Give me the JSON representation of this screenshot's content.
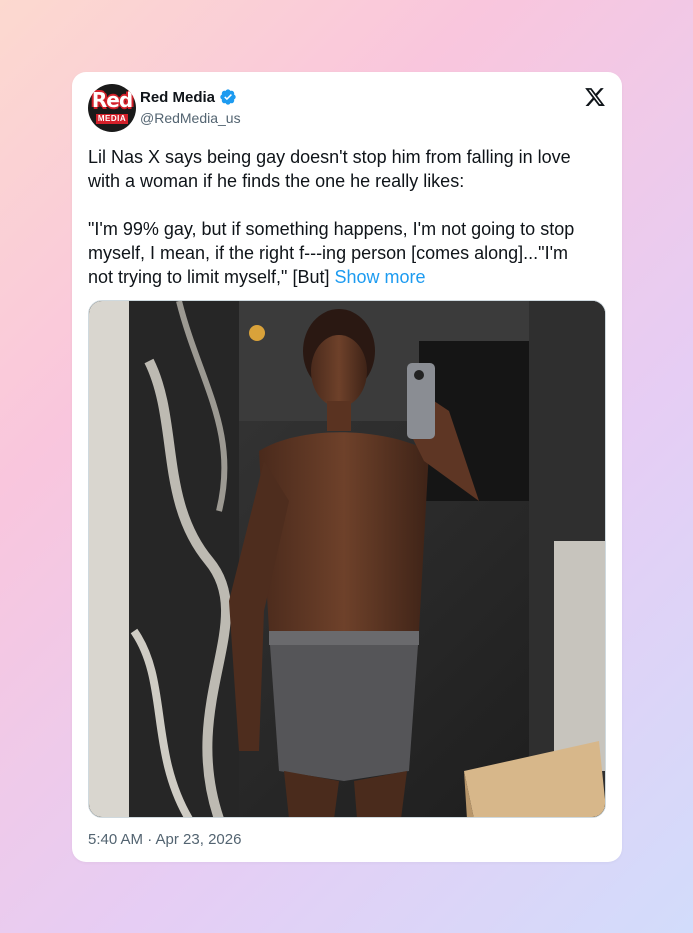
{
  "tweet": {
    "author": {
      "name": "Red Media",
      "handle": "@RedMedia_us",
      "verified": true,
      "avatar_text_top": "Red",
      "avatar_text_bottom": "MEDIA"
    },
    "platform_icon": "x-logo-icon",
    "text_paragraph_1": "Lil Nas X says being gay doesn't stop him from falling in love with a woman if he finds the one he really likes:",
    "text_paragraph_2": "\"I'm 99% gay, but if something happens, I'm not going to stop myself, I mean, if the right f---ing person [comes along]...\"I'm not trying to limit myself,\" [But]",
    "show_more_label": "Show more",
    "media": {
      "type": "photo",
      "icon": "mirror-selfie-photo"
    },
    "timestamp": "5:40 AM · Apr 23, 2026"
  },
  "colors": {
    "link": "#1d9bf0",
    "verified": "#1d9bf0",
    "text_primary": "#0f1419",
    "text_secondary": "#536471",
    "brand_red": "#d3202a"
  }
}
